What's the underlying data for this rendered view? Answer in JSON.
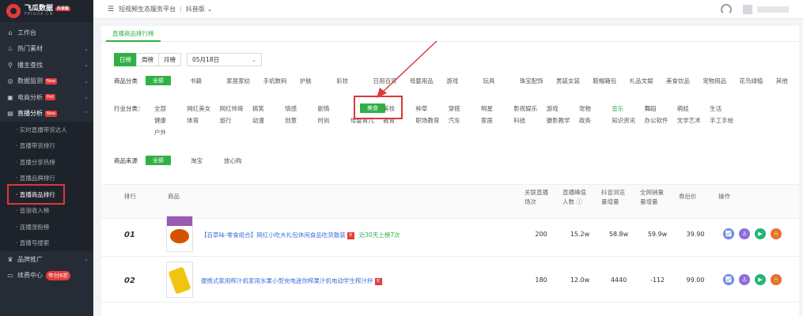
{
  "brand": {
    "title": "飞瓜数据",
    "badge": "抖音版",
    "sub": "FEIGUA.CN"
  },
  "sidebar": {
    "items": [
      {
        "label": "工作台",
        "icon": "home-icon"
      },
      {
        "label": "热门素材",
        "icon": "fire-icon"
      },
      {
        "label": "播主查找",
        "icon": "user-search-icon"
      },
      {
        "label": "数据监测",
        "badge": "New",
        "icon": "monitor-icon"
      },
      {
        "label": "电商分析",
        "badge": "Hot",
        "icon": "cart-icon"
      },
      {
        "label": "直播分析",
        "badge": "New",
        "icon": "live-icon"
      }
    ],
    "sub_items": [
      "· 实时直播带货达人",
      "· 直播带货排行",
      "· 直播分享热榜",
      "· 直播品牌排行",
      "· 直播商品排行",
      "· 音浪收入榜",
      "· 连播涨粉榜",
      "· 直播号搜索"
    ],
    "bottom": [
      {
        "label": "品牌推广",
        "icon": "brand-icon"
      },
      {
        "label": "续费中心",
        "badge": "年付6折",
        "icon": "renew-icon"
      }
    ]
  },
  "topbar": {
    "title": "短视频生态服务平台",
    "version": "抖音版"
  },
  "tab": "直播商品排行榜",
  "period_buttons": [
    "日榜",
    "周榜",
    "月榜"
  ],
  "date": "05月18日",
  "categories": {
    "label": "商品分类",
    "all": "全部",
    "options": [
      "书籍",
      "家居家纺",
      "手机数码",
      "护肤",
      "彩妆",
      "日用百货",
      "母婴用品",
      "游戏",
      "玩具",
      "珠宝配饰",
      "男装女装",
      "鞋帽箱包",
      "礼品文娱",
      "美食饮品",
      "宠物用品",
      "花鸟绿植",
      "其他"
    ]
  },
  "industry": {
    "label": "行业分类：",
    "row1": [
      "全部",
      "网红美女",
      "网红帅哥",
      "搞笑",
      "情感",
      "剧情",
      "美食",
      "美妆",
      "种草",
      "穿搭",
      "明星",
      "影视娱乐",
      "游戏",
      "宠物",
      "音乐",
      "舞蹈",
      "萌娃",
      "生活"
    ],
    "row2": [
      "健康",
      "体育",
      "旅行",
      "动漫",
      "创意",
      "时尚",
      "母婴育儿",
      "教育",
      "职场教育",
      "汽车",
      "家居",
      "科技",
      "摄影教学",
      "政务",
      "知识资讯",
      "办公软件",
      "文学艺术",
      "手工手绘"
    ],
    "row3": [
      "户外"
    ]
  },
  "source": {
    "label": "商品来源",
    "options": [
      "全部",
      "淘宝",
      "放心购"
    ]
  },
  "table": {
    "headers": {
      "rank": "排行",
      "product": "商品",
      "sessions": [
        "关联直播",
        "场次"
      ],
      "peak": [
        "直播峰值",
        "人数"
      ],
      "views": [
        "抖音浏览",
        "量增量"
      ],
      "sales": [
        "全网销量",
        "量增量"
      ],
      "price": "券后价",
      "ops": "操作"
    },
    "rows": [
      {
        "rank": "01",
        "name": "【百草味-零食组合】网红小吃大礼包休闲食品吃货散装",
        "note": "近30天上榜7次",
        "sessions": "200",
        "peak": "15.2w",
        "views": "58.8w",
        "sales": "59.9w",
        "price": "39.90"
      },
      {
        "rank": "02",
        "name": "便携式家用榨汁机家用水果小型充电迷你榨果汁机电动学生榨汁杯",
        "note": "",
        "sessions": "180",
        "peak": "12.0w",
        "views": "4440",
        "sales": "-112",
        "price": "99.00"
      }
    ]
  },
  "colors": {
    "accent": "#31b045",
    "highlight": "#d93a3a",
    "sidebar": "#262c36"
  }
}
